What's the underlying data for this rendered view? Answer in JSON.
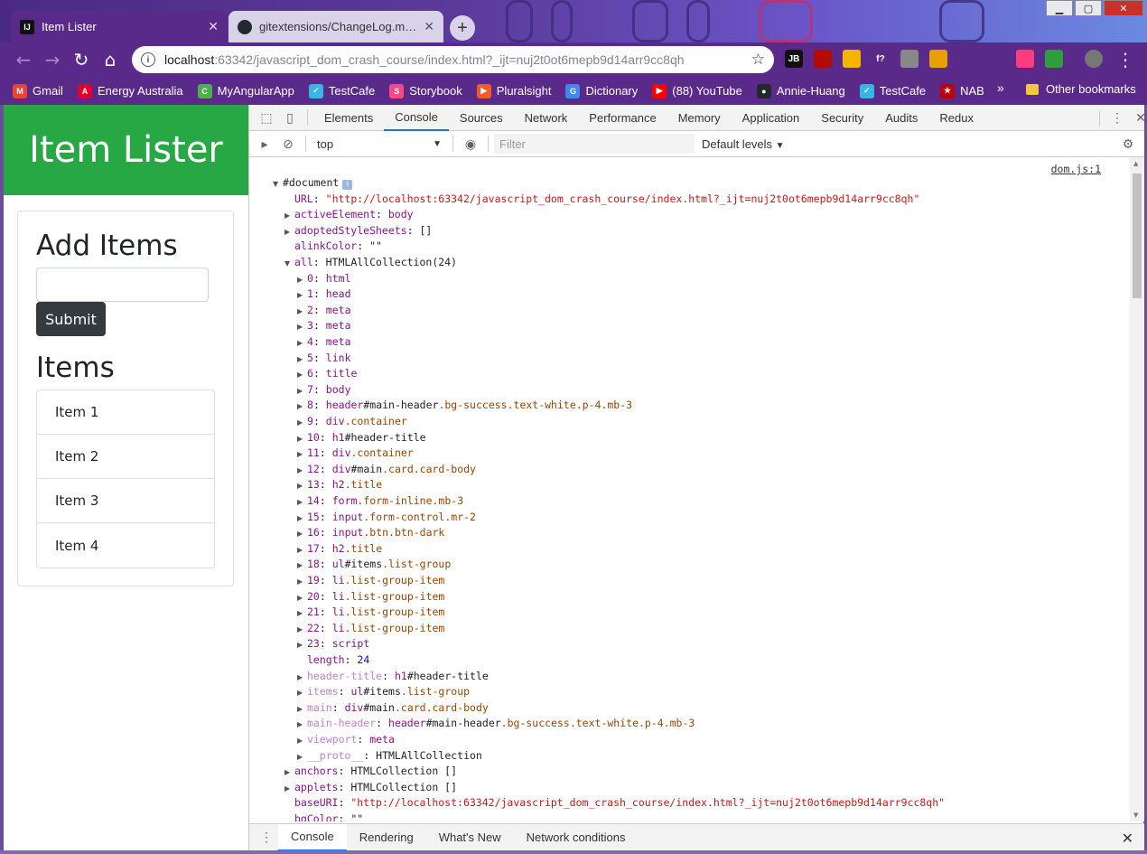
{
  "browser": {
    "tabs": [
      {
        "label": "Item Lister",
        "icon": "intellij-icon",
        "icon_text": "IJ"
      },
      {
        "label": "gitextensions/ChangeLog.md at m",
        "icon": "github-icon"
      }
    ],
    "url_host": "localhost",
    "url_path": ":63342/javascript_dom_crash_course/index.html?_ijt=nuj2t0ot6mepb9d14arr9cc8qh",
    "extensions": [
      {
        "name": "jetbrains-ext-icon",
        "text": "JB",
        "color": "#111111"
      },
      {
        "name": "pdf-ext-icon",
        "text": "",
        "color": "#b30b00"
      },
      {
        "name": "notes-ext-icon",
        "text": "",
        "color": "#f4b400"
      },
      {
        "name": "font-ext-icon",
        "text": "f?",
        "color": "#5a2a8a"
      },
      {
        "name": "camera-ext-icon",
        "text": "",
        "color": "#888888"
      },
      {
        "name": "color-picker-ext-icon",
        "text": "",
        "color": "#e8a000"
      },
      {
        "name": "react-ext-icon",
        "text": "",
        "color": "#5a2a8a"
      },
      {
        "name": "target-ext-icon",
        "text": "",
        "color": "#5a2a8a"
      },
      {
        "name": "colorwheel-ext-icon",
        "text": "",
        "color": "#ff3b7f"
      },
      {
        "name": "chart-ext-icon",
        "text": "",
        "color": "#2e9e3c"
      },
      {
        "name": "profile-avatar-icon",
        "text": "",
        "color": "#777777"
      }
    ],
    "bookmarks": [
      {
        "label": "Gmail",
        "icon": "gmail-icon",
        "color": "#ea4335",
        "glyph": "M"
      },
      {
        "label": "Energy Australia",
        "icon": "angular-icon",
        "color": "#dd0031",
        "glyph": "A"
      },
      {
        "label": "MyAngularApp",
        "icon": "app-icon",
        "color": "#4caf50",
        "glyph": "C"
      },
      {
        "label": "TestCafe",
        "icon": "testcafe-icon",
        "color": "#36b6e5",
        "glyph": "✓"
      },
      {
        "label": "Storybook",
        "icon": "storybook-icon",
        "color": "#ff4785",
        "glyph": "S"
      },
      {
        "label": "Pluralsight",
        "icon": "pluralsight-icon",
        "color": "#f15b2a",
        "glyph": "▶"
      },
      {
        "label": "Dictionary",
        "icon": "google-icon",
        "color": "#4285f4",
        "glyph": "G"
      },
      {
        "label": "(88) YouTube",
        "icon": "youtube-icon",
        "color": "#ff0000",
        "glyph": "▶"
      },
      {
        "label": "Annie-Huang",
        "icon": "github-icon",
        "color": "#24292e",
        "glyph": "●"
      },
      {
        "label": "TestCafe",
        "icon": "testcafe-icon",
        "color": "#36b6e5",
        "glyph": "✓"
      },
      {
        "label": "NAB",
        "icon": "nab-icon",
        "color": "#c20000",
        "glyph": "★"
      }
    ],
    "more_bookmarks": "»",
    "other_bookmarks": "Other bookmarks"
  },
  "page": {
    "header_title": "Item Lister",
    "add_heading": "Add Items",
    "submit_label": "Submit",
    "items_heading": "Items",
    "items": [
      "Item 1",
      "Item 2",
      "Item 3",
      "Item 4"
    ]
  },
  "devtools": {
    "tabs": [
      "Elements",
      "Console",
      "Sources",
      "Network",
      "Performance",
      "Memory",
      "Application",
      "Security",
      "Audits",
      "Redux"
    ],
    "active_tab": "Console",
    "context": "top",
    "filter_placeholder": "Filter",
    "levels": "Default levels",
    "source_link": "dom.js:1",
    "drawer_tabs": [
      "Console",
      "Rendering",
      "What's New",
      "Network conditions"
    ],
    "lines": [
      {
        "i": 0,
        "tri": "▼",
        "parts": [
          [
            "plain",
            "#document"
          ]
        ],
        "badge": "i"
      },
      {
        "i": 1,
        "tri": "",
        "parts": [
          [
            "k",
            "URL"
          ],
          [
            "plain",
            ": "
          ],
          [
            "s",
            "\"http://localhost:63342/javascript_dom_crash_course/index.html?_ijt=nuj2t0ot6mepb9d14arr9cc8qh\""
          ]
        ]
      },
      {
        "i": 1,
        "tri": "▶",
        "parts": [
          [
            "k",
            "activeElement"
          ],
          [
            "plain",
            ": "
          ],
          [
            "t",
            "body"
          ]
        ]
      },
      {
        "i": 1,
        "tri": "▶",
        "parts": [
          [
            "k",
            "adoptedStyleSheets"
          ],
          [
            "plain",
            ": []"
          ]
        ]
      },
      {
        "i": 1,
        "tri": "",
        "parts": [
          [
            "k",
            "alinkColor"
          ],
          [
            "plain",
            ": \"\""
          ]
        ]
      },
      {
        "i": 1,
        "tri": "▼",
        "parts": [
          [
            "k",
            "all"
          ],
          [
            "plain",
            ": HTMLAllCollection(24)"
          ]
        ]
      },
      {
        "i": 2,
        "tri": "▶",
        "parts": [
          [
            "k",
            "0"
          ],
          [
            "plain",
            ": "
          ],
          [
            "t",
            "html"
          ]
        ]
      },
      {
        "i": 2,
        "tri": "▶",
        "parts": [
          [
            "k",
            "1"
          ],
          [
            "plain",
            ": "
          ],
          [
            "t",
            "head"
          ]
        ]
      },
      {
        "i": 2,
        "tri": "▶",
        "parts": [
          [
            "k",
            "2"
          ],
          [
            "plain",
            ": "
          ],
          [
            "t",
            "meta"
          ]
        ]
      },
      {
        "i": 2,
        "tri": "▶",
        "parts": [
          [
            "k",
            "3"
          ],
          [
            "plain",
            ": "
          ],
          [
            "t",
            "meta"
          ]
        ]
      },
      {
        "i": 2,
        "tri": "▶",
        "parts": [
          [
            "k",
            "4"
          ],
          [
            "plain",
            ": "
          ],
          [
            "t",
            "meta"
          ]
        ]
      },
      {
        "i": 2,
        "tri": "▶",
        "parts": [
          [
            "k",
            "5"
          ],
          [
            "plain",
            ": "
          ],
          [
            "t",
            "link"
          ]
        ]
      },
      {
        "i": 2,
        "tri": "▶",
        "parts": [
          [
            "k",
            "6"
          ],
          [
            "plain",
            ": "
          ],
          [
            "t",
            "title"
          ]
        ]
      },
      {
        "i": 2,
        "tri": "▶",
        "parts": [
          [
            "k",
            "7"
          ],
          [
            "plain",
            ": "
          ],
          [
            "t",
            "body"
          ]
        ]
      },
      {
        "i": 2,
        "tri": "▶",
        "parts": [
          [
            "k",
            "8"
          ],
          [
            "plain",
            ": "
          ],
          [
            "t",
            "header"
          ],
          [
            "plain",
            "#main-header"
          ],
          [
            "cls",
            ".bg-success.text-white.p-4.mb-3"
          ]
        ]
      },
      {
        "i": 2,
        "tri": "▶",
        "parts": [
          [
            "k",
            "9"
          ],
          [
            "plain",
            ": "
          ],
          [
            "t",
            "div"
          ],
          [
            "cls",
            ".container"
          ]
        ]
      },
      {
        "i": 2,
        "tri": "▶",
        "parts": [
          [
            "k",
            "10"
          ],
          [
            "plain",
            ": "
          ],
          [
            "t",
            "h1"
          ],
          [
            "plain",
            "#header-title"
          ]
        ]
      },
      {
        "i": 2,
        "tri": "▶",
        "parts": [
          [
            "k",
            "11"
          ],
          [
            "plain",
            ": "
          ],
          [
            "t",
            "div"
          ],
          [
            "cls",
            ".container"
          ]
        ]
      },
      {
        "i": 2,
        "tri": "▶",
        "parts": [
          [
            "k",
            "12"
          ],
          [
            "plain",
            ": "
          ],
          [
            "t",
            "div"
          ],
          [
            "plain",
            "#main"
          ],
          [
            "cls",
            ".card.card-body"
          ]
        ]
      },
      {
        "i": 2,
        "tri": "▶",
        "parts": [
          [
            "k",
            "13"
          ],
          [
            "plain",
            ": "
          ],
          [
            "t",
            "h2"
          ],
          [
            "cls",
            ".title"
          ]
        ]
      },
      {
        "i": 2,
        "tri": "▶",
        "parts": [
          [
            "k",
            "14"
          ],
          [
            "plain",
            ": "
          ],
          [
            "t",
            "form"
          ],
          [
            "cls",
            ".form-inline.mb-3"
          ]
        ]
      },
      {
        "i": 2,
        "tri": "▶",
        "parts": [
          [
            "k",
            "15"
          ],
          [
            "plain",
            ": "
          ],
          [
            "t",
            "input"
          ],
          [
            "cls",
            ".form-control.mr-2"
          ]
        ]
      },
      {
        "i": 2,
        "tri": "▶",
        "parts": [
          [
            "k",
            "16"
          ],
          [
            "plain",
            ": "
          ],
          [
            "t",
            "input"
          ],
          [
            "cls",
            ".btn.btn-dark"
          ]
        ]
      },
      {
        "i": 2,
        "tri": "▶",
        "parts": [
          [
            "k",
            "17"
          ],
          [
            "plain",
            ": "
          ],
          [
            "t",
            "h2"
          ],
          [
            "cls",
            ".title"
          ]
        ]
      },
      {
        "i": 2,
        "tri": "▶",
        "parts": [
          [
            "k",
            "18"
          ],
          [
            "plain",
            ": "
          ],
          [
            "t",
            "ul"
          ],
          [
            "plain",
            "#items"
          ],
          [
            "cls",
            ".list-group"
          ]
        ]
      },
      {
        "i": 2,
        "tri": "▶",
        "parts": [
          [
            "k",
            "19"
          ],
          [
            "plain",
            ": "
          ],
          [
            "t",
            "li"
          ],
          [
            "cls",
            ".list-group-item"
          ]
        ]
      },
      {
        "i": 2,
        "tri": "▶",
        "parts": [
          [
            "k",
            "20"
          ],
          [
            "plain",
            ": "
          ],
          [
            "t",
            "li"
          ],
          [
            "cls",
            ".list-group-item"
          ]
        ]
      },
      {
        "i": 2,
        "tri": "▶",
        "parts": [
          [
            "k",
            "21"
          ],
          [
            "plain",
            ": "
          ],
          [
            "t",
            "li"
          ],
          [
            "cls",
            ".list-group-item"
          ]
        ]
      },
      {
        "i": 2,
        "tri": "▶",
        "parts": [
          [
            "k",
            "22"
          ],
          [
            "plain",
            ": "
          ],
          [
            "t",
            "li"
          ],
          [
            "cls",
            ".list-group-item"
          ]
        ]
      },
      {
        "i": 2,
        "tri": "▶",
        "parts": [
          [
            "k",
            "23"
          ],
          [
            "plain",
            ": "
          ],
          [
            "t",
            "script"
          ]
        ]
      },
      {
        "i": 2,
        "tri": "",
        "parts": [
          [
            "k",
            "length"
          ],
          [
            "plain",
            ": "
          ],
          [
            "n",
            "24"
          ]
        ]
      },
      {
        "i": 2,
        "tri": "▶",
        "parts": [
          [
            "kd",
            "header-title"
          ],
          [
            "plain",
            ": "
          ],
          [
            "t",
            "h1"
          ],
          [
            "plain",
            "#header-title"
          ]
        ]
      },
      {
        "i": 2,
        "tri": "▶",
        "parts": [
          [
            "kd",
            "items"
          ],
          [
            "plain",
            ": "
          ],
          [
            "t",
            "ul"
          ],
          [
            "plain",
            "#items"
          ],
          [
            "cls",
            ".list-group"
          ]
        ]
      },
      {
        "i": 2,
        "tri": "▶",
        "parts": [
          [
            "kd",
            "main"
          ],
          [
            "plain",
            ": "
          ],
          [
            "t",
            "div"
          ],
          [
            "plain",
            "#main"
          ],
          [
            "cls",
            ".card.card-body"
          ]
        ]
      },
      {
        "i": 2,
        "tri": "▶",
        "parts": [
          [
            "kd",
            "main-header"
          ],
          [
            "plain",
            ": "
          ],
          [
            "t",
            "header"
          ],
          [
            "plain",
            "#main-header"
          ],
          [
            "cls",
            ".bg-success.text-white.p-4.mb-3"
          ]
        ]
      },
      {
        "i": 2,
        "tri": "▶",
        "parts": [
          [
            "kd",
            "viewport"
          ],
          [
            "plain",
            ": "
          ],
          [
            "t",
            "meta"
          ]
        ]
      },
      {
        "i": 2,
        "tri": "▶",
        "parts": [
          [
            "kd",
            "__proto__"
          ],
          [
            "plain",
            ": HTMLAllCollection"
          ]
        ]
      },
      {
        "i": 1,
        "tri": "▶",
        "parts": [
          [
            "k",
            "anchors"
          ],
          [
            "plain",
            ": HTMLCollection []"
          ]
        ]
      },
      {
        "i": 1,
        "tri": "▶",
        "parts": [
          [
            "k",
            "applets"
          ],
          [
            "plain",
            ": HTMLCollection []"
          ]
        ]
      },
      {
        "i": 1,
        "tri": "",
        "parts": [
          [
            "k",
            "baseURI"
          ],
          [
            "plain",
            ": "
          ],
          [
            "s",
            "\"http://localhost:63342/javascript_dom_crash_course/index.html?_ijt=nuj2t0ot6mepb9d14arr9cc8qh\""
          ]
        ]
      },
      {
        "i": 1,
        "tri": "",
        "parts": [
          [
            "k",
            "bgColor"
          ],
          [
            "plain",
            ": \"\""
          ]
        ]
      }
    ]
  }
}
